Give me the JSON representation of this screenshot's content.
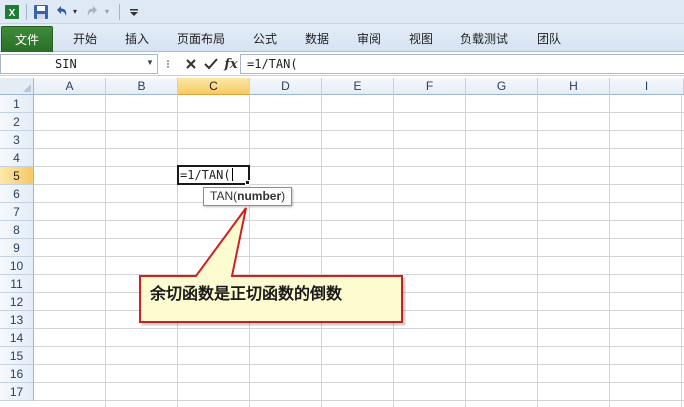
{
  "quick_access": {
    "icons": [
      "excel-logo-icon",
      "save-icon",
      "undo-icon",
      "redo-icon",
      "customize-icon"
    ]
  },
  "ribbon": {
    "tabs": [
      {
        "id": "file",
        "label": "文件"
      },
      {
        "id": "home",
        "label": "开始"
      },
      {
        "id": "insert",
        "label": "插入"
      },
      {
        "id": "layout",
        "label": "页面布局"
      },
      {
        "id": "formulas",
        "label": "公式"
      },
      {
        "id": "data",
        "label": "数据"
      },
      {
        "id": "review",
        "label": "审阅"
      },
      {
        "id": "view",
        "label": "视图"
      },
      {
        "id": "loadtest",
        "label": "负载测试"
      },
      {
        "id": "team",
        "label": "团队"
      }
    ]
  },
  "formula_bar": {
    "name_box": "SIN",
    "fx_label": "fx",
    "content": "=1/TAN("
  },
  "sheet": {
    "columns": [
      "A",
      "B",
      "C",
      "D",
      "E",
      "F",
      "G",
      "H",
      "I"
    ],
    "rows": [
      "1",
      "2",
      "3",
      "4",
      "5",
      "6",
      "7",
      "8",
      "9",
      "10",
      "11",
      "12",
      "13",
      "14",
      "15",
      "16",
      "17"
    ],
    "active_column": "C",
    "active_row": "5",
    "active_cell_text": "=1/TAN("
  },
  "tooltip": {
    "func": "TAN(",
    "arg": "number",
    "close": ")"
  },
  "callout": {
    "text": "余切函数是正切函数的倒数",
    "fill": "#fdfbd0",
    "border": "#d02020"
  }
}
